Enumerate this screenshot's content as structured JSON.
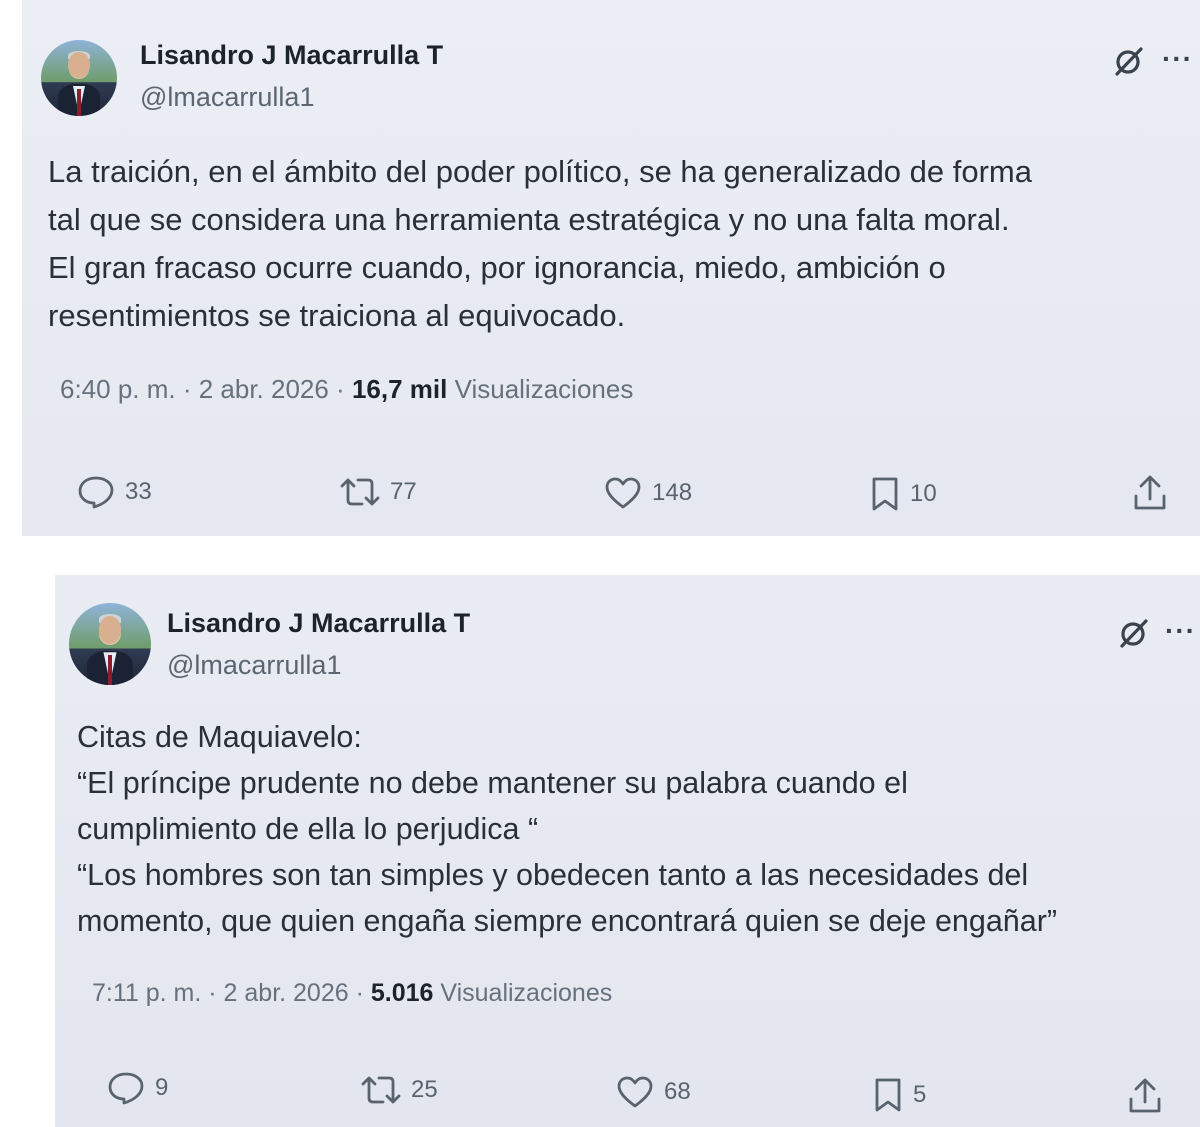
{
  "tweets": [
    {
      "author_name": "Lisandro J Macarrulla T",
      "handle": "@lmacarrulla1",
      "lines": [
        "La traición, en el ámbito del poder político, se ha generalizado de forma",
        "tal que se considera una herramienta estratégica y no una falta moral.",
        "El gran fracaso ocurre cuando, por ignorancia, miedo, ambición o",
        "resentimientos se traiciona al equivocado."
      ],
      "meta_time": "6:40 p. m. · 2 abr. 2026 · ",
      "views_count": "16,7 mil",
      "views_label": " Visualizaciones",
      "replies": "33",
      "reposts": "77",
      "likes": "148",
      "bookmarks": "10"
    },
    {
      "author_name": "Lisandro J Macarrulla T",
      "handle": "@lmacarrulla1",
      "lines": [
        "Citas de Maquiavelo:",
        "“El príncipe prudente no debe mantener su palabra cuando el",
        "cumplimiento de ella lo perjudica “",
        "“Los hombres son tan simples y obedecen tanto a las necesidades del",
        "momento, que quien engaña siempre encontrará quien se deje engañar”"
      ],
      "meta_time": "7:11 p. m. · 2 abr. 2026 · ",
      "views_count": "5.016",
      "views_label": " Visualizaciones",
      "replies": "9",
      "reposts": "25",
      "likes": "68",
      "bookmarks": "5"
    }
  ],
  "icons": {
    "grok": "grok-icon",
    "more": "more-icon",
    "reply": "reply-icon",
    "repost": "repost-icon",
    "like": "heart-icon",
    "bookmark": "bookmark-icon",
    "share": "share-icon"
  },
  "colors": {
    "text_primary": "#0f1419",
    "text_secondary": "#5b6670",
    "background": "#e8eaf3"
  }
}
